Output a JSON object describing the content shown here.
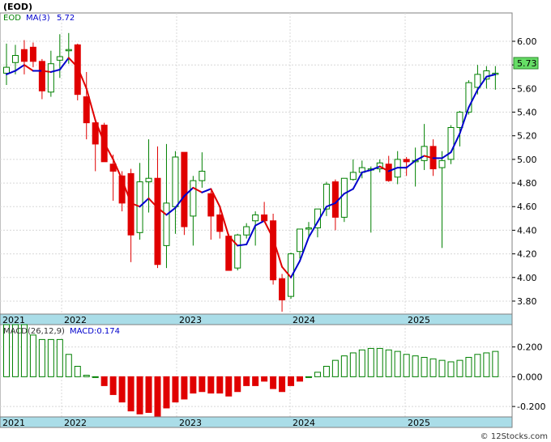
{
  "ticker_label": "(EOD)",
  "legend": {
    "eod_label": "EOD",
    "ma_label": "MA(3)",
    "ma_value": "5.72"
  },
  "last_price_label": "5.73",
  "macd": {
    "label": "MACD(26,12,9)",
    "value_label": "MACD:0.174"
  },
  "watermark": "© 12Stocks.com",
  "colors": {
    "up": "#008000",
    "down": "#e00000",
    "ma_up": "#0000cc",
    "ma_down": "#e00000",
    "axis_band": "#aadde8",
    "last_price_box": "#66dd66"
  },
  "chart_data": [
    {
      "type": "candlestick",
      "title": "",
      "x_axis_labels": [
        "2021",
        "2022",
        "2023",
        "2024",
        "2025"
      ],
      "y_ticks": [
        "6.00",
        "5.80",
        "5.60",
        "5.40",
        "5.20",
        "5.00",
        "4.80",
        "4.60",
        "4.40",
        "4.20",
        "4.00",
        "3.80"
      ],
      "ylim": [
        3.69,
        6.24
      ],
      "grid": true,
      "series": [
        {
          "name": "EOD",
          "candles": [
            [
              5.73,
              5.98,
              5.63,
              5.78
            ],
            [
              5.82,
              5.97,
              5.72,
              5.88
            ],
            [
              5.93,
              6.01,
              5.72,
              5.83
            ],
            [
              5.95,
              5.99,
              5.78,
              5.83
            ],
            [
              5.83,
              5.85,
              5.51,
              5.58
            ],
            [
              5.57,
              5.92,
              5.53,
              5.81
            ],
            [
              5.84,
              6.06,
              5.69,
              5.87
            ],
            [
              5.93,
              6.07,
              5.81,
              5.93
            ],
            [
              5.97,
              5.98,
              5.5,
              5.55
            ],
            [
              5.53,
              5.74,
              5.17,
              5.31
            ],
            [
              5.31,
              5.34,
              4.9,
              5.13
            ],
            [
              5.29,
              5.31,
              4.98,
              4.98
            ],
            [
              4.96,
              5.04,
              4.65,
              4.9
            ],
            [
              4.86,
              4.9,
              4.56,
              4.63
            ],
            [
              4.88,
              4.92,
              4.13,
              4.36
            ],
            [
              4.38,
              4.97,
              4.32,
              4.81
            ],
            [
              4.81,
              5.17,
              4.55,
              4.84
            ],
            [
              4.84,
              5.11,
              4.08,
              4.11
            ],
            [
              4.27,
              5.13,
              4.08,
              4.63
            ],
            [
              4.6,
              5.07,
              4.37,
              5.02
            ],
            [
              5.06,
              5.06,
              4.36,
              4.43
            ],
            [
              4.52,
              4.86,
              4.27,
              4.82
            ],
            [
              4.82,
              5.06,
              4.76,
              4.9
            ],
            [
              4.71,
              4.73,
              4.32,
              4.52
            ],
            [
              4.53,
              4.6,
              4.33,
              4.39
            ],
            [
              4.35,
              4.37,
              4.12,
              4.06
            ],
            [
              4.08,
              4.37,
              4.06,
              4.36
            ],
            [
              4.36,
              4.46,
              4.33,
              4.43
            ],
            [
              4.48,
              4.56,
              4.27,
              4.53
            ],
            [
              4.53,
              4.64,
              4.48,
              4.48
            ],
            [
              4.48,
              4.54,
              3.94,
              3.98
            ],
            [
              3.99,
              4.03,
              3.71,
              3.81
            ],
            [
              3.84,
              4.21,
              3.82,
              4.2
            ],
            [
              4.22,
              4.33,
              4.16,
              4.41
            ],
            [
              4.42,
              4.47,
              4.35,
              4.42
            ],
            [
              4.42,
              4.58,
              4.34,
              4.58
            ],
            [
              4.58,
              4.81,
              4.52,
              4.79
            ],
            [
              4.81,
              4.83,
              4.4,
              4.51
            ],
            [
              4.51,
              4.84,
              4.47,
              4.84
            ],
            [
              4.83,
              5.0,
              4.82,
              4.89
            ],
            [
              4.89,
              4.99,
              4.84,
              4.93
            ],
            [
              4.92,
              4.94,
              4.38,
              4.92
            ],
            [
              4.92,
              5.0,
              4.89,
              4.97
            ],
            [
              4.96,
              5.03,
              4.81,
              4.82
            ],
            [
              4.85,
              5.07,
              4.79,
              5.0
            ],
            [
              5.0,
              5.02,
              4.86,
              4.98
            ],
            [
              4.98,
              5.1,
              4.77,
              4.99
            ],
            [
              4.99,
              5.3,
              4.91,
              5.11
            ],
            [
              5.11,
              5.17,
              4.86,
              4.92
            ],
            [
              4.93,
              5.07,
              4.25,
              4.99
            ],
            [
              5.0,
              5.29,
              4.96,
              5.27
            ],
            [
              5.27,
              5.41,
              5.11,
              5.4
            ],
            [
              5.4,
              5.67,
              5.38,
              5.65
            ],
            [
              5.61,
              5.8,
              5.55,
              5.72
            ],
            [
              5.68,
              5.79,
              5.6,
              5.75
            ],
            [
              5.73,
              5.79,
              5.59,
              5.73
            ]
          ]
        },
        {
          "name": "MA(3)",
          "values": [
            5.72,
            5.75,
            5.8,
            5.75,
            5.75,
            5.74,
            5.76,
            5.86,
            5.78,
            5.6,
            5.33,
            5.14,
            5.0,
            4.83,
            4.63,
            4.6,
            4.67,
            4.59,
            4.53,
            4.59,
            4.69,
            4.76,
            4.72,
            4.75,
            4.6,
            4.35,
            4.27,
            4.28,
            4.44,
            4.48,
            4.33,
            4.09,
            4.0,
            4.14,
            4.34,
            4.47,
            4.6,
            4.63,
            4.71,
            4.75,
            4.89,
            4.91,
            4.94,
            4.9,
            4.93,
            4.93,
            4.99,
            5.03,
            5.01,
            5.01,
            5.06,
            5.22,
            5.44,
            5.59,
            5.7,
            5.72
          ]
        }
      ]
    },
    {
      "type": "bar",
      "title": "",
      "y_ticks": [
        "0.200",
        "0.000",
        "-0.200"
      ],
      "ylim": [
        -0.27,
        0.35
      ],
      "grid": true,
      "series": [
        {
          "name": "MACD(26,12,9)",
          "values": [
            0.35,
            0.35,
            0.35,
            0.28,
            0.25,
            0.25,
            0.25,
            0.15,
            0.07,
            0.01,
            0.0,
            -0.06,
            -0.12,
            -0.17,
            -0.23,
            -0.25,
            -0.24,
            -0.27,
            -0.21,
            -0.17,
            -0.15,
            -0.11,
            -0.1,
            -0.11,
            -0.11,
            -0.13,
            -0.1,
            -0.06,
            -0.06,
            -0.03,
            -0.08,
            -0.1,
            -0.06,
            -0.03,
            0.0,
            0.03,
            0.07,
            0.11,
            0.14,
            0.16,
            0.18,
            0.19,
            0.19,
            0.18,
            0.17,
            0.15,
            0.14,
            0.13,
            0.12,
            0.11,
            0.1,
            0.11,
            0.13,
            0.15,
            0.16,
            0.17
          ]
        }
      ]
    }
  ]
}
